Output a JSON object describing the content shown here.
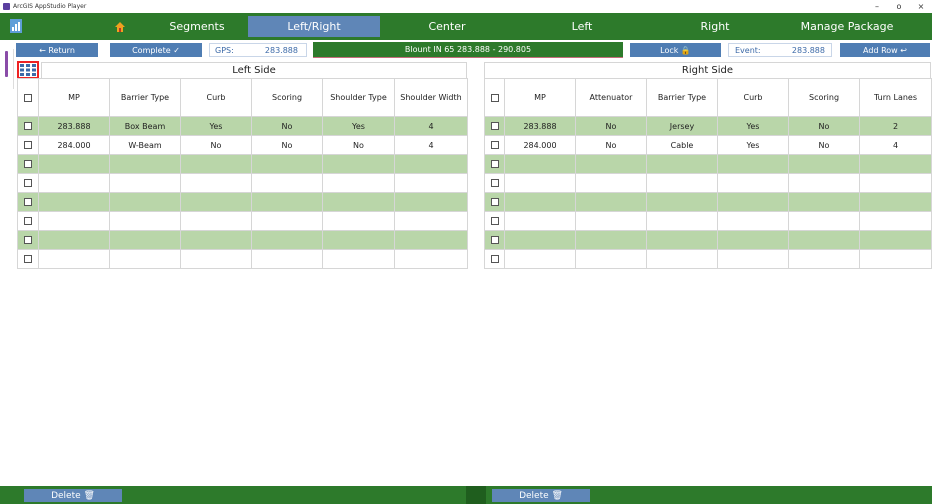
{
  "window": {
    "title": "ArcGIS AppStudio Player",
    "minimize": "–",
    "maximize": "o",
    "close": "×"
  },
  "nav": {
    "tabs": [
      {
        "label": "Segments",
        "active": false
      },
      {
        "label": "Left/Right",
        "active": true
      },
      {
        "label": "Center",
        "active": false
      },
      {
        "label": "Left",
        "active": false
      },
      {
        "label": "Right",
        "active": false
      },
      {
        "label": "Manage Package",
        "active": false
      }
    ]
  },
  "toolbar": {
    "return_label": "← Return",
    "complete_label": "Complete ✓",
    "gps_label": "GPS:",
    "gps_value": "283.888",
    "segment": "Blount IN 65 283.888 - 290.805",
    "lock_label": "Lock 🔒",
    "event_label": "Event:",
    "event_value": "283.888",
    "add_row_label": "Add Row ↩"
  },
  "left_table": {
    "title": "Left Side",
    "columns": [
      "MP",
      "Barrier Type",
      "Curb",
      "Scoring",
      "Shoulder Type",
      "Shoulder Width"
    ],
    "rows": [
      [
        "283.888",
        "Box Beam",
        "Yes",
        "No",
        "Yes",
        "4"
      ],
      [
        "284.000",
        "W-Beam",
        "No",
        "No",
        "No",
        "4"
      ],
      [
        "",
        "",
        "",
        "",
        "",
        ""
      ],
      [
        "",
        "",
        "",
        "",
        "",
        ""
      ],
      [
        "",
        "",
        "",
        "",
        "",
        ""
      ],
      [
        "",
        "",
        "",
        "",
        "",
        ""
      ],
      [
        "",
        "",
        "",
        "",
        "",
        ""
      ],
      [
        "",
        "",
        "",
        "",
        "",
        ""
      ]
    ]
  },
  "right_table": {
    "title": "Right Side",
    "columns": [
      "MP",
      "Attenuator",
      "Barrier Type",
      "Curb",
      "Scoring",
      "Turn Lanes"
    ],
    "rows": [
      [
        "283.888",
        "No",
        "Jersey",
        "Yes",
        "No",
        "2"
      ],
      [
        "284.000",
        "No",
        "Cable",
        "Yes",
        "No",
        "4"
      ],
      [
        "",
        "",
        "",
        "",
        "",
        ""
      ],
      [
        "",
        "",
        "",
        "",
        "",
        ""
      ],
      [
        "",
        "",
        "",
        "",
        "",
        ""
      ],
      [
        "",
        "",
        "",
        "",
        "",
        ""
      ],
      [
        "",
        "",
        "",
        "",
        "",
        ""
      ],
      [
        "",
        "",
        "",
        "",
        "",
        ""
      ]
    ]
  },
  "bottom": {
    "delete_left": "Delete 🗑",
    "delete_right": "Delete 🗑"
  },
  "colors": {
    "nav_green": "#2d7a2b",
    "row_green": "#b9d6a9",
    "button_blue": "#4f7db3",
    "active_tab": "#5f86b7"
  }
}
